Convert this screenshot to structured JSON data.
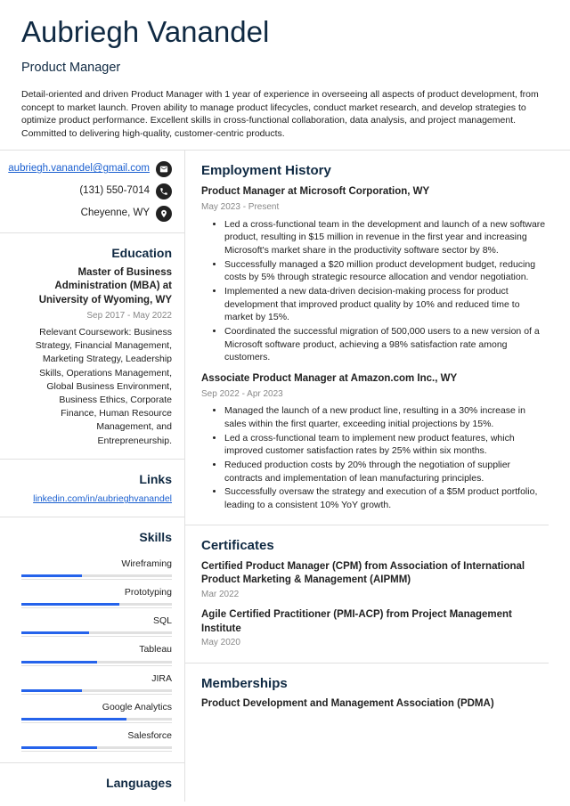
{
  "name": "Aubriegh Vanandel",
  "title": "Product Manager",
  "summary": "Detail-oriented and driven Product Manager with 1 year of experience in overseeing all aspects of product development, from concept to market launch. Proven ability to manage product lifecycles, conduct market research, and develop strategies to optimize product performance. Excellent skills in cross-functional collaboration, data analysis, and project management. Committed to delivering high-quality, customer-centric products.",
  "contact": {
    "email": "aubriegh.vanandel@gmail.com",
    "phone": "(131) 550-7014",
    "location": "Cheyenne, WY"
  },
  "sections": {
    "education": "Education",
    "links": "Links",
    "skills": "Skills",
    "languages": "Languages",
    "employment": "Employment History",
    "certificates": "Certificates",
    "memberships": "Memberships"
  },
  "education": {
    "degree": "Master of Business Administration (MBA) at University of Wyoming, WY",
    "dates": "Sep 2017 - May 2022",
    "coursework": "Relevant Coursework: Business Strategy, Financial Management, Marketing Strategy, Leadership Skills, Operations Management, Global Business Environment, Business Ethics, Corporate Finance, Human Resource Management, and Entrepreneurship."
  },
  "links": {
    "linkedin": "linkedin.com/in/aubrieghvanandel"
  },
  "skills": [
    {
      "name": "Wireframing",
      "level": 40
    },
    {
      "name": "Prototyping",
      "level": 65
    },
    {
      "name": "SQL",
      "level": 45
    },
    {
      "name": "Tableau",
      "level": 50
    },
    {
      "name": "JIRA",
      "level": 40
    },
    {
      "name": "Google Analytics",
      "level": 70
    },
    {
      "name": "Salesforce",
      "level": 50
    }
  ],
  "jobs": [
    {
      "title": "Product Manager at Microsoft Corporation, WY",
      "dates": "May 2023 - Present",
      "bullets": [
        "Led a cross-functional team in the development and launch of a new software product, resulting in $15 million in revenue in the first year and increasing Microsoft's market share in the productivity software sector by 8%.",
        "Successfully managed a $20 million product development budget, reducing costs by 5% through strategic resource allocation and vendor negotiation.",
        "Implemented a new data-driven decision-making process for product development that improved product quality by 10% and reduced time to market by 15%.",
        "Coordinated the successful migration of 500,000 users to a new version of a Microsoft software product, achieving a 98% satisfaction rate among customers."
      ]
    },
    {
      "title": "Associate Product Manager at Amazon.com Inc., WY",
      "dates": "Sep 2022 - Apr 2023",
      "bullets": [
        "Managed the launch of a new product line, resulting in a 30% increase in sales within the first quarter, exceeding initial projections by 15%.",
        "Led a cross-functional team to implement new product features, which improved customer satisfaction rates by 25% within six months.",
        "Reduced production costs by 20% through the negotiation of supplier contracts and implementation of lean manufacturing principles.",
        "Successfully oversaw the strategy and execution of a $5M product portfolio, leading to a consistent 10% YoY growth."
      ]
    }
  ],
  "certificates": [
    {
      "name": "Certified Product Manager (CPM) from Association of International Product Marketing & Management (AIPMM)",
      "date": "Mar 2022"
    },
    {
      "name": "Agile Certified Practitioner (PMI-ACP) from Project Management Institute",
      "date": "May 2020"
    }
  ],
  "memberships": [
    {
      "name": "Product Development and Management Association (PDMA)"
    }
  ]
}
